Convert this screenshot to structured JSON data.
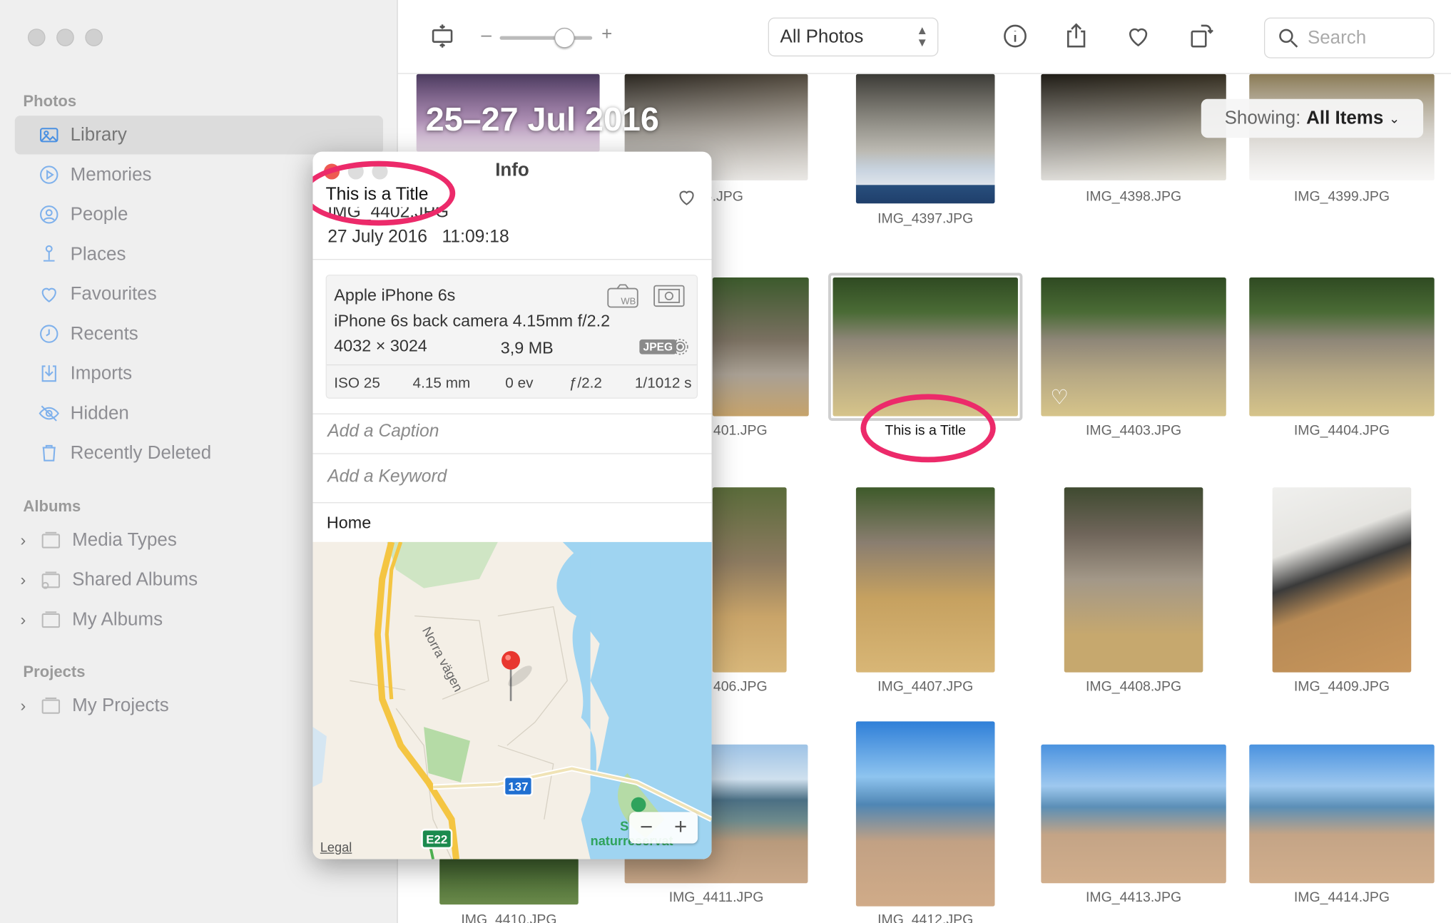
{
  "sidebar": {
    "section_photos": "Photos",
    "items": [
      {
        "label": "Library",
        "icon": "library-icon"
      },
      {
        "label": "Memories",
        "icon": "memories-icon"
      },
      {
        "label": "People",
        "icon": "people-icon"
      },
      {
        "label": "Places",
        "icon": "places-icon"
      },
      {
        "label": "Favourites",
        "icon": "heart-icon"
      },
      {
        "label": "Recents",
        "icon": "clock-icon"
      },
      {
        "label": "Imports",
        "icon": "import-icon"
      },
      {
        "label": "Hidden",
        "icon": "hidden-icon"
      },
      {
        "label": "Recently Deleted",
        "icon": "trash-icon"
      }
    ],
    "section_albums": "Albums",
    "albums": [
      {
        "label": "Media Types"
      },
      {
        "label": "Shared Albums"
      },
      {
        "label": "My Albums"
      }
    ],
    "section_projects": "Projects",
    "projects": [
      {
        "label": "My Projects"
      }
    ]
  },
  "toolbar": {
    "zoom_minus": "–",
    "zoom_plus": "+",
    "zoom_level": 0.7,
    "view_select": "All Photos",
    "search_placeholder": "Search"
  },
  "grid": {
    "date_header": "25–27 Jul 2016",
    "showing_label": "Showing:",
    "showing_value": "All Items",
    "captions": {
      "c4396": "396.JPG",
      "c4397": "IMG_4397.JPG",
      "c4398": "IMG_4398.JPG",
      "c4399": "IMG_4399.JPG",
      "c4401": "401.JPG",
      "c4402": "This is a Title",
      "c4403": "IMG_4403.JPG",
      "c4404": "IMG_4404.JPG",
      "c4406": "406.JPG",
      "c4407": "IMG_4407.JPG",
      "c4408": "IMG_4408.JPG",
      "c4409": "IMG_4409.JPG",
      "c4410": "IMG_4410.JPG",
      "c4411": "IMG_4411.JPG",
      "c4412": "IMG_4412.JPG",
      "c4413": "IMG_4413.JPG",
      "c4414": "IMG_4414.JPG"
    }
  },
  "info": {
    "window_title": "Info",
    "title": "This is a Title",
    "filename": "IMG_4402.JPG",
    "date": "27 July 2016",
    "time": "11:09:18",
    "camera": "Apple iPhone 6s",
    "lens": "iPhone 6s back camera 4.15mm f/2.2",
    "dimensions": "4032 × 3024",
    "filesize": "3,9 MB",
    "format": "JPEG",
    "iso": "ISO 25",
    "focal": "4.15 mm",
    "ev": "0 ev",
    "aperture": "ƒ/2.2",
    "shutter": "1/1012 s",
    "caption_placeholder": "Add a Caption",
    "keyword_placeholder": "Add a Keyword",
    "place": "Home",
    "map": {
      "road_label": "Norra vägen",
      "shield_137": "137",
      "shield_e22": "E22",
      "poi_s": "S",
      "poi_label": "naturreservat",
      "legal": "Legal",
      "zoom_out": "−",
      "zoom_in": "+"
    }
  }
}
